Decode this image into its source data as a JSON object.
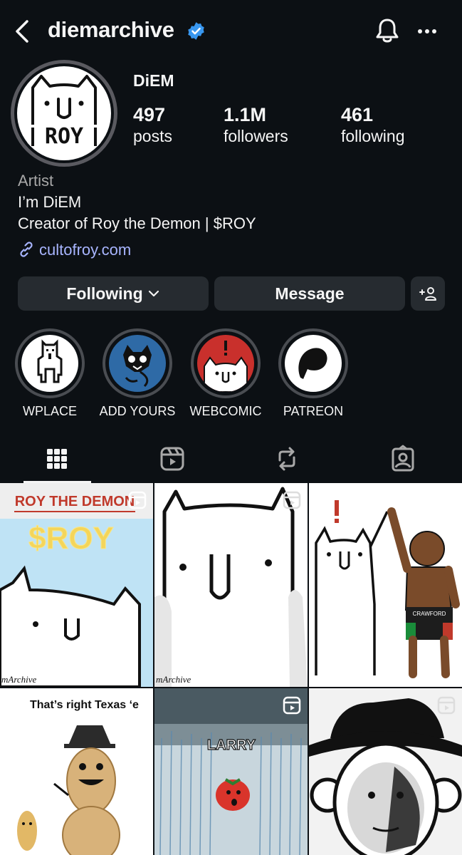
{
  "header": {
    "username": "diemarchive",
    "verified": true,
    "icons": [
      "back-chevron-icon",
      "verified-badge-icon",
      "notification-bell-icon",
      "more-options-icon"
    ]
  },
  "profile": {
    "display_name": "DiEM",
    "avatar_text": "ROY",
    "stats": [
      {
        "value": "497",
        "label": "posts"
      },
      {
        "value": "1.1M",
        "label": "followers"
      },
      {
        "value": "461",
        "label": "following"
      }
    ],
    "category": "Artist",
    "bio_line1": "I’m DiEM",
    "bio_line2": "Creator of Roy the Demon | $ROY",
    "link": "cultofroy.com"
  },
  "actions": {
    "following": "Following",
    "message": "Message"
  },
  "highlights": [
    {
      "label": "WPLACE"
    },
    {
      "label": "ADD YOURS"
    },
    {
      "label": "WEBCOMIC"
    },
    {
      "label": "PATREON"
    }
  ],
  "tabs": [
    "grid-icon",
    "reels-icon",
    "reposts-icon",
    "tagged-icon"
  ],
  "posts": [
    {
      "caption": "ROY THE DEMON",
      "overlay": "$ROY",
      "watermark": "mArchive",
      "is_reel": true
    },
    {
      "watermark": "mArchive",
      "is_reel": true
    },
    {
      "shorts_label": "CRAWFORD",
      "is_reel": false
    },
    {
      "caption": "That’s right Texas ‘e",
      "is_reel": false
    },
    {
      "caption": "LARRY",
      "is_reel": true
    },
    {
      "is_reel": true
    }
  ],
  "colors": {
    "background": "#0c1014",
    "button": "#262b30",
    "link": "#a8b5ff",
    "verified": "#3897f0",
    "muted": "#a8a8a8"
  }
}
